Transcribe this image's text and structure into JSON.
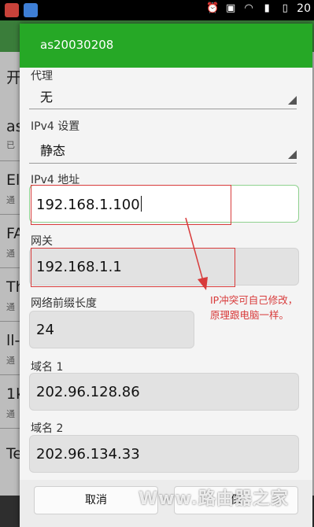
{
  "status_bar": {
    "time": "20"
  },
  "dialog": {
    "title": "as20030208",
    "proxy": {
      "label": "代理",
      "value": "无"
    },
    "ipv4_settings": {
      "label": "IPv4 设置",
      "value": "静态"
    },
    "ipv4_address": {
      "label": "IPv4 地址",
      "value": "192.168.1.100"
    },
    "gateway": {
      "label": "网关",
      "value": "192.168.1.1"
    },
    "prefix_length": {
      "label": "网络前缀长度",
      "value": "24"
    },
    "dns1": {
      "label": "域名 1",
      "value": "202.96.128.86"
    },
    "dns2": {
      "label": "域名 2",
      "value": "202.96.134.33"
    },
    "cancel_label": "取消",
    "save_label": "保"
  },
  "annotation": {
    "line1": "IP冲突可自己修改，",
    "line2": "原理跟电脑一样。"
  },
  "background_list": {
    "chars": [
      "开",
      "as",
      "El",
      "FA",
      "Th",
      "ll-",
      "1k",
      "Te"
    ],
    "subs": [
      "已",
      "通",
      "通",
      "通",
      "通",
      "通"
    ]
  },
  "watermark": "Www.路由器之家",
  "colors": {
    "title_bar": "#26a826",
    "annotation": "#d83b3b"
  }
}
